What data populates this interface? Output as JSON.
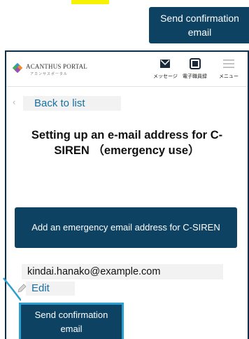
{
  "callout": {
    "send_confirmation_label": "Send confirmation email"
  },
  "header": {
    "logo_text": "ACANTHUS PORTAL",
    "logo_subtext": "アカンサスポータル",
    "nav": [
      {
        "label": "メッセージ",
        "icon": "envelope-icon"
      },
      {
        "label": "電子職員録",
        "icon": "staff-directory-icon"
      },
      {
        "label": "メニュー",
        "icon": "hamburger-menu-icon"
      }
    ]
  },
  "back": {
    "label": "Back to list"
  },
  "page": {
    "title": "Setting up an e-mail address for C-SIREN （emergency use）"
  },
  "add_button": {
    "label": "Add an emergency email address for C-SIREN"
  },
  "email": {
    "value": "kindai.hanako@example.com"
  },
  "edit": {
    "label": "Edit"
  },
  "send_button": {
    "label": "Send confirmation email"
  },
  "colors": {
    "accent": "#0d4263",
    "link": "#1a6f9c",
    "highlight_border": "#2a9fd0",
    "marker_yellow": "#f7f200"
  }
}
